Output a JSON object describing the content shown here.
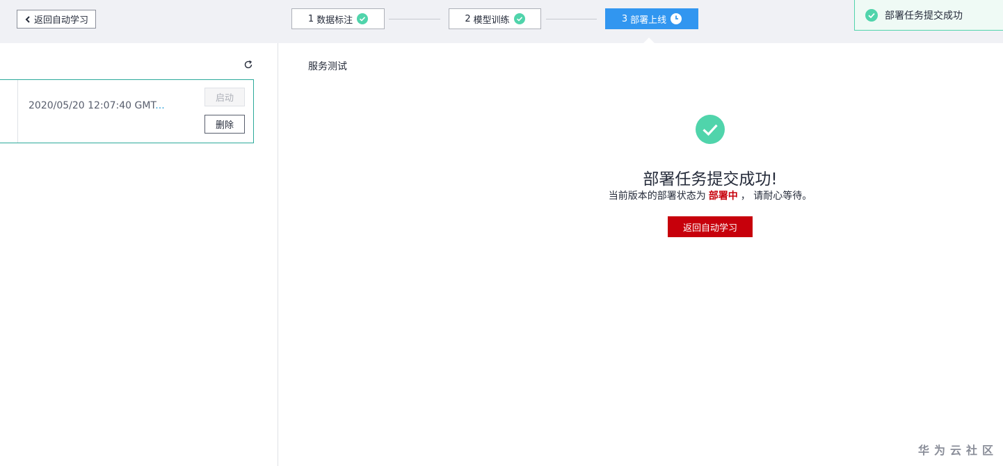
{
  "header": {
    "back_label": "返回自动学习",
    "steps": [
      {
        "num": "1",
        "label": "数据标注",
        "status": "done"
      },
      {
        "num": "2",
        "label": "模型训练",
        "status": "done"
      },
      {
        "num": "3",
        "label": "部署上线",
        "status": "in-progress"
      }
    ]
  },
  "toast": {
    "message": "部署任务提交成功"
  },
  "left_panel": {
    "version": {
      "time": "2020/05/20 12:07:40 GMT",
      "ellipsis": "...",
      "start_label": "启动",
      "delete_label": "删除"
    }
  },
  "main": {
    "section_title": "服务测试",
    "success_title": "部署任务提交成功!",
    "desc_prefix": "当前版本的部署状态为",
    "state_label": "部署中",
    "desc_suffix": "，  请耐心等待。",
    "button_label": "返回自动学习"
  },
  "watermark": "华为云社区",
  "colors": {
    "active_step": "#3196f0",
    "success_green": "#50d4ab",
    "primary_red": "#c7000b",
    "card_border": "#2ba99a"
  }
}
